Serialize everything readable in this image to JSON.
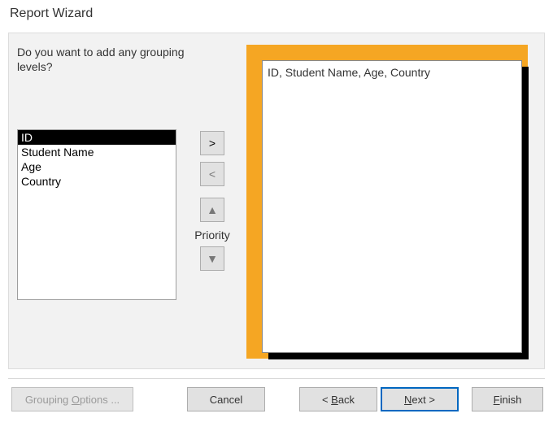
{
  "title": "Report Wizard",
  "prompt": "Do you want to add any grouping levels?",
  "fields": {
    "items": [
      {
        "label": "ID",
        "selected": true
      },
      {
        "label": "Student Name",
        "selected": false
      },
      {
        "label": "Age",
        "selected": false
      },
      {
        "label": "Country",
        "selected": false
      }
    ]
  },
  "midbuttons": {
    "add": ">",
    "remove": "<",
    "priority_label": "Priority",
    "up": "⬆",
    "down": "⬇"
  },
  "preview": {
    "text": "ID, Student Name, Age, Country"
  },
  "footer": {
    "grouping_options_pre": "Grouping ",
    "grouping_options_u": "O",
    "grouping_options_post": "ptions ...",
    "cancel": "Cancel",
    "back_pre": "< ",
    "back_u": "B",
    "back_post": "ack",
    "next_u": "N",
    "next_post": "ext >",
    "finish_u": "F",
    "finish_post": "inish"
  }
}
